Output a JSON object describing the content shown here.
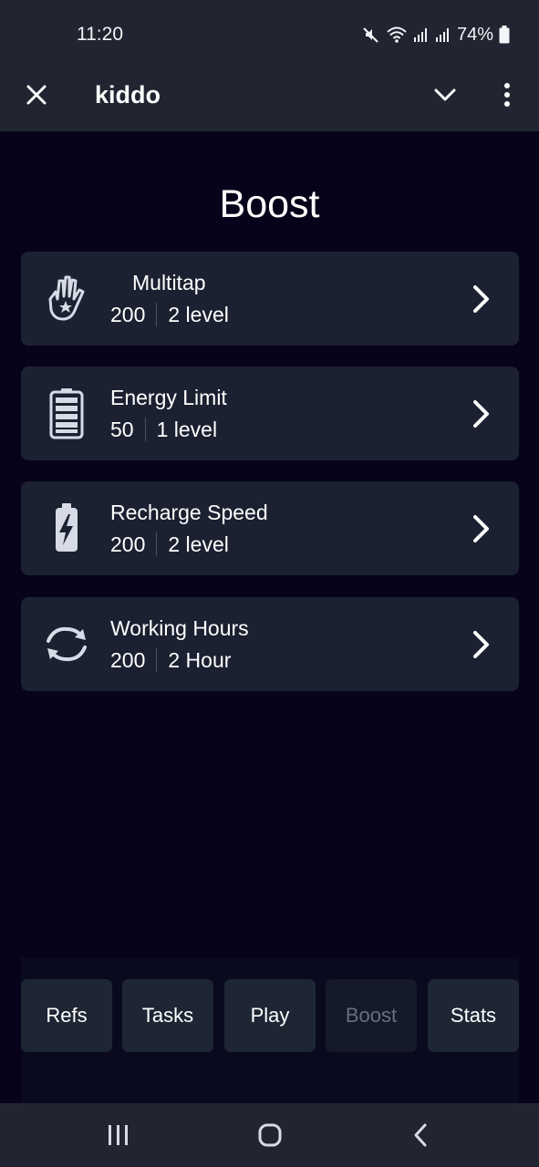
{
  "status": {
    "time": "11:20",
    "battery": "74%"
  },
  "app_bar": {
    "title": "kiddo"
  },
  "page": {
    "title": "Boost"
  },
  "boosts": [
    {
      "icon": "hand-star-icon",
      "name": "Multitap",
      "value": "200",
      "level": "2 level"
    },
    {
      "icon": "battery-icon",
      "name": "Energy Limit",
      "value": "50",
      "level": "1 level"
    },
    {
      "icon": "battery-charging-icon",
      "name": "Recharge Speed",
      "value": "200",
      "level": "2 level"
    },
    {
      "icon": "refresh-icon",
      "name": "Working Hours",
      "value": "200",
      "level": "2 Hour"
    }
  ],
  "bottom_nav": [
    {
      "label": "Refs"
    },
    {
      "label": "Tasks"
    },
    {
      "label": "Play"
    },
    {
      "label": "Boost",
      "active": true
    },
    {
      "label": "Stats"
    }
  ],
  "colors": {
    "background": "#07031a",
    "bar": "#212531",
    "card": "#1c2131",
    "button": "#1e2634",
    "button_active_text": "#6a6e7a"
  }
}
